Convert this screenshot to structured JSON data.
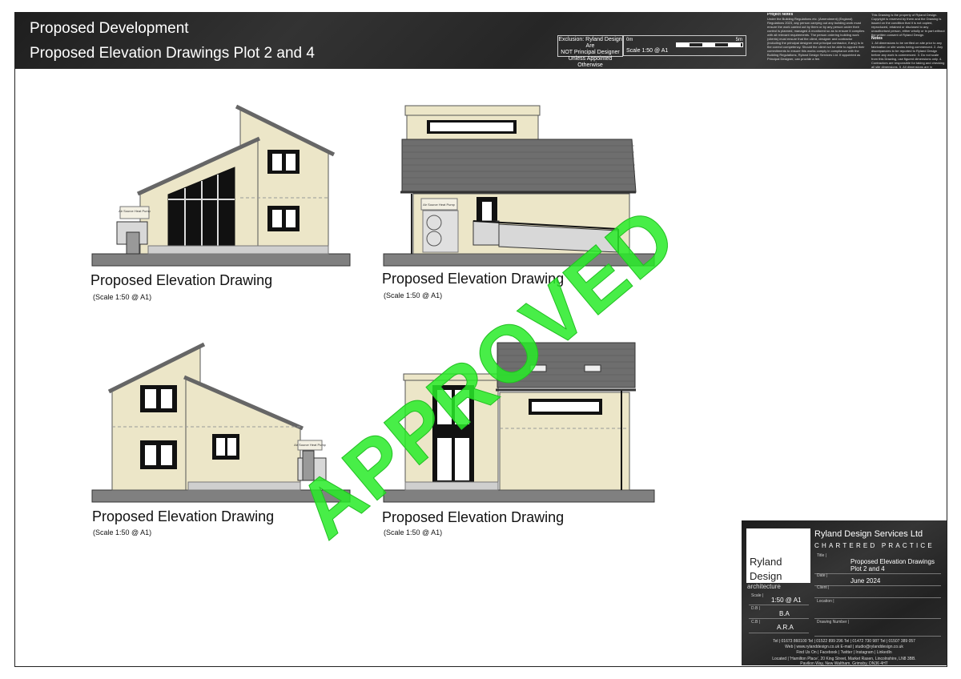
{
  "header": {
    "title_1": "Proposed Development",
    "title_2": "Proposed Elevation Drawings Plot 2 and 4",
    "exclusion_line1": "Exclusion: Ryland Design Are",
    "exclusion_line2": "NOT Principal Designer",
    "exclusion_line3": "Unless Appointed Otherwise",
    "scale_start": "0m",
    "scale_end": "5m",
    "scale_label": "Scale 1:50 @ A1",
    "project_notes_title": "Project Notes",
    "project_notes": "Under the Building Regulations etc. (Amendment) (England) Regulations 2023, any person carrying out any building work must ensure the work carried out by them or by any person under their control is planned, managed & monitored so as to ensure it complies with all relevant requirements. The person ordering building work (clients) must ensure that the client, designer and contractor (including the principal designer and principal contractor, if any) is in the correct competency. Should the client not be able to appoint their commitments to ensure this works comply in compliance with the Building Regulations, Ryland Design Services Ltd. If appointed as Principal Designer, can provide a fee.",
    "copyright_note": "This Drawing is the property of Ryland Design. Copyright is reserved by them and the Drawing is issued on the condition that it is not copied, reproduced, retained or disclosed to any unauthorised person, either wholly or in part without the written consent of Ryland Design.",
    "notes_title": "Notes",
    "notes": "1. All dimensions to be verified on site prior to any fabrication or site works being commenced. 2. Any discrepancies to be reported to Ryland Design before any work is commenced. 3. Do not scale from this Drawing, use figured dimensions only. 4. Contractors are responsible for taking and checking all site dimensions. 5. All dimensions are in millimetres unless stated otherwise. 6. This Drawing is to be read in conjunction with relevant Consultant and Specialist Drawings. 7. This Drawing is to be read in conjunction with Drawing Nos."
  },
  "drawings": [
    {
      "caption": "Proposed Elevation Drawing",
      "scale": "(Scale 1:50 @ A1)",
      "ashp_label": "Air Source Heat Pump"
    },
    {
      "caption": "Proposed Elevation Drawing",
      "scale": "(Scale 1:50 @ A1)",
      "ashp_label": "Air Source Heat Pump"
    },
    {
      "caption": "Proposed Elevation Drawing",
      "scale": "(Scale 1:50 @ A1)",
      "ashp_label": "Air Source Heat Pump"
    },
    {
      "caption": "Proposed Elevation Drawing",
      "scale": "(Scale 1:50 @ A1)"
    }
  ],
  "stamp": "APPROVED",
  "title_block": {
    "logo_line1": "Ryland",
    "logo_line2": "Design",
    "logo_line3": "architecture",
    "company": "Ryland Design Services Ltd",
    "chartered": "CHARTERED PRACTICE",
    "title_label": "Title |",
    "title_value": "Proposed Elevation Drawings Plot 2 and 4",
    "date_label": "Date |",
    "date_value": "June 2024",
    "client_label": "Client |",
    "location_label": "Location |",
    "drawing_number_label": "Drawing Number |",
    "scale_label": "Scale |",
    "scale_value": "1:50 @ A1",
    "db_label": "D.B |",
    "db_value": "B.A",
    "cb_label": "C.B |",
    "cb_value": "A.R.A",
    "tel": "Tel | 01673 860100   Tel | 01522 899 296   Tel | 01472 730 987   Tel | 01507 389 057",
    "web": "Web | www.rylanddesign.co.uk   E-mail | studio@rylanddesign.co.uk",
    "social": "Find Us On | Facebook | Twitter | Instagram | LinkedIn",
    "located_1": "Located | 'Hamilton Place', 20 King Street, Market Rasen, Lincolnshire, LN8 3BB.",
    "located_2": "Pavilion Way, New Waltham, Grimsby, DN36 4HT"
  },
  "colors": {
    "cladding": "#ece6c8",
    "roof": "#6e6e6e",
    "ground": "#808080",
    "stamp": "#22ee22"
  }
}
